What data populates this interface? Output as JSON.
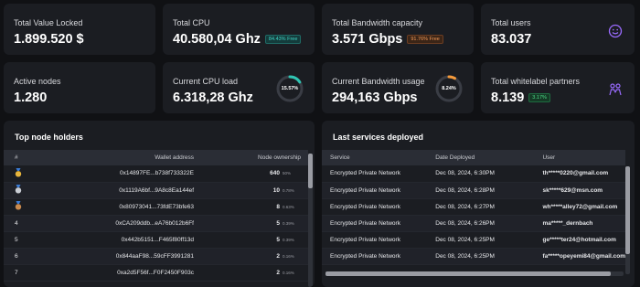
{
  "stats": {
    "tvl": {
      "label": "Total Value Locked",
      "value": "1.899.520 $"
    },
    "cpu": {
      "label": "Total CPU",
      "value": "40.580,04 Ghz",
      "badge": "84.43% Free"
    },
    "bandwidth": {
      "label": "Total Bandwidth capacity",
      "value": "3.571 Gbps",
      "badge": "91.76% Free"
    },
    "users": {
      "label": "Total users",
      "value": "83.037",
      "icon": "smiley-icon"
    },
    "nodes": {
      "label": "Active nodes",
      "value": "1.280"
    },
    "cpu_load": {
      "label": "Current CPU load",
      "value": "6.318,28 Ghz",
      "gauge_label": "15.57%",
      "gauge_fraction": 0.1557
    },
    "bw_usage": {
      "label": "Current Bandwidth usage",
      "value": "294,163 Gbps",
      "gauge_label": "8.24%",
      "gauge_fraction": 0.0824
    },
    "partners": {
      "label": "Total whitelabel partners",
      "value": "8.139",
      "badge": "3.17%",
      "icon": "people-icon"
    }
  },
  "colors": {
    "teal": "#2fc4b2",
    "orange": "#f59a3b",
    "purple": "#9a6bff"
  },
  "node_holders": {
    "title": "Top node holders",
    "columns": [
      "#",
      "Wallet address",
      "Node ownership"
    ],
    "rows": [
      {
        "rank": "",
        "medal": "gold-medal-icon",
        "wallet": "0x14897FE...b738f733322E",
        "nodes": "640",
        "pct": "50%"
      },
      {
        "rank": "",
        "medal": "silver-medal-icon",
        "wallet": "0x1119A6bf...9A8c8Ea144ef",
        "nodes": "10",
        "pct": "0.78%"
      },
      {
        "rank": "",
        "medal": "bronze-medal-icon",
        "wallet": "0x80973041...73fdE73bfe63",
        "nodes": "8",
        "pct": "0.63%"
      },
      {
        "rank": "4",
        "medal": "",
        "wallet": "0xCA209ddb...eA76b012b6Ff",
        "nodes": "5",
        "pct": "0.39%"
      },
      {
        "rank": "5",
        "medal": "",
        "wallet": "0x442b5151...F465f80ff13d",
        "nodes": "5",
        "pct": "0.39%"
      },
      {
        "rank": "6",
        "medal": "",
        "wallet": "0x844aaF98...59cFF3991281",
        "nodes": "2",
        "pct": "0.16%"
      },
      {
        "rank": "7",
        "medal": "",
        "wallet": "0xa2d5F56f...F0F2450F903c",
        "nodes": "2",
        "pct": "0.16%"
      }
    ]
  },
  "services": {
    "title": "Last services deployed",
    "columns": [
      "Service",
      "Date Deployed",
      "User"
    ],
    "rows": [
      {
        "service": "Encrypted Private Network",
        "date": "Dec 08, 2024, 6:30PM",
        "user": "th*****0220@gmail.com"
      },
      {
        "service": "Encrypted Private Network",
        "date": "Dec 08, 2024, 6:28PM",
        "user": "sk*****629@msn.com"
      },
      {
        "service": "Encrypted Private Network",
        "date": "Dec 08, 2024, 6:27PM",
        "user": "wh*****alley72@gmail.com"
      },
      {
        "service": "Encrypted Private Network",
        "date": "Dec 08, 2024, 6:26PM",
        "user": "ma*****_dernbach"
      },
      {
        "service": "Encrypted Private Network",
        "date": "Dec 08, 2024, 6:25PM",
        "user": "ge*****ter24@hotmail.com"
      },
      {
        "service": "Encrypted Private Network",
        "date": "Dec 08, 2024, 6:25PM",
        "user": "fa*****opeyemi84@gmail.com"
      }
    ]
  }
}
